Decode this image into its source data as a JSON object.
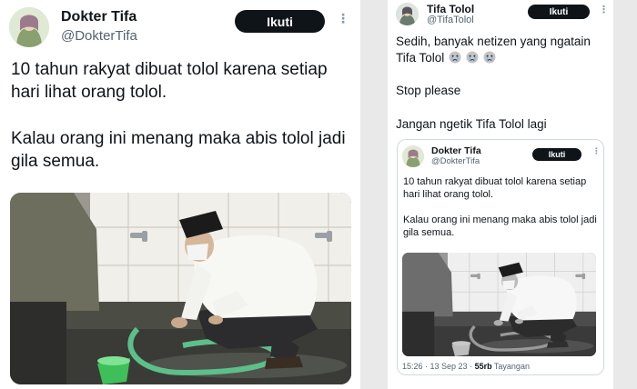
{
  "left_tweet": {
    "name": "Dokter Tifa",
    "handle": "@DokterTifa",
    "follow_label": "Ikuti",
    "more": "⋮",
    "text_lines": [
      "10 tahun rakyat dibuat tolol karena setiap hari lihat orang tolol.",
      "Kalau orang ini menang maka abis tolol jadi gila semua."
    ]
  },
  "right_tweet": {
    "name": "Tifa Tolol",
    "handle": "@TifaTolol",
    "follow_label": "Ikuti",
    "more": "⋮",
    "text_line_1": "Sedih, banyak netizen yang ngatain Tifa Tolol",
    "emoji_name": "crying-face-emoji",
    "text_line_2": "Stop please",
    "text_line_3": "Jangan ngetik Tifa Tolol lagi",
    "quoted": {
      "name": "Dokter Tifa",
      "handle": "@DokterTifa",
      "follow_label": "Ikuti",
      "more": "⋮",
      "text_lines": [
        "10 tahun rakyat dibuat tolol karena setiap hari lihat orang tolol.",
        "Kalau orang ini menang maka abis tolol jadi gila semua."
      ],
      "meta_time": "15:26 · 13 Sep 23 · ",
      "meta_views_count": "55rb",
      "meta_views_label": " Tayangan"
    }
  },
  "colors": {
    "primary_text": "#0f1419",
    "secondary_text": "#536471",
    "follow_button": "#0f1419",
    "hose_green": "#5dbf8a",
    "bucket_green": "#3fbf5a"
  }
}
